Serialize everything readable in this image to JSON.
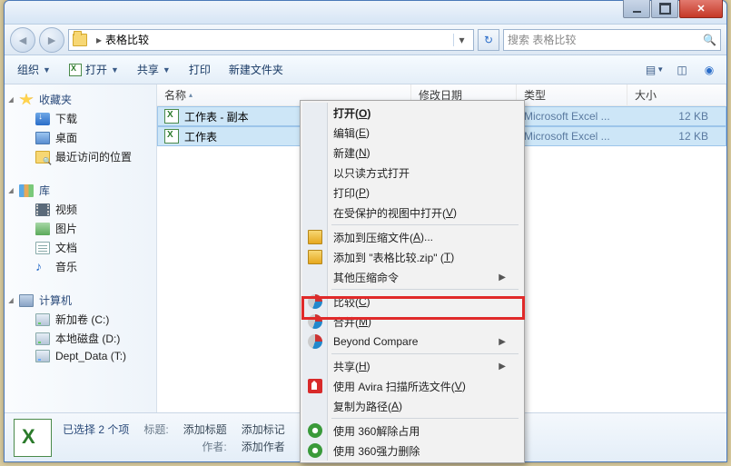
{
  "titlebar": {
    "minimize": "",
    "maximize": "",
    "close": ""
  },
  "nav": {
    "path_segment": "表格比较",
    "search_placeholder": "搜索 表格比较"
  },
  "toolbar": {
    "organize": "组织",
    "open": "打开",
    "share": "共享",
    "print": "打印",
    "new_folder": "新建文件夹"
  },
  "columns": {
    "name": "名称",
    "modified": "修改日期",
    "type": "类型",
    "size": "大小"
  },
  "files": [
    {
      "name": "工作表 - 副本",
      "type": "Microsoft Excel ...",
      "size": "12 KB"
    },
    {
      "name": "工作表",
      "type": "Microsoft Excel ...",
      "size": "12 KB"
    }
  ],
  "sidebar": {
    "favorites": {
      "head": "收藏夹",
      "items": [
        "下载",
        "桌面",
        "最近访问的位置"
      ]
    },
    "libraries": {
      "head": "库",
      "items": [
        "视频",
        "图片",
        "文档",
        "音乐"
      ]
    },
    "computer": {
      "head": "计算机",
      "items": [
        "新加卷 (C:)",
        "本地磁盘 (D:)",
        "Dept_Data (T:)"
      ]
    }
  },
  "context_menu": {
    "open": "打开(",
    "open_k": "O",
    "open_e": ")",
    "edit": "编辑(",
    "edit_k": "E",
    "edit_e": ")",
    "new": "新建(",
    "new_k": "N",
    "new_e": ")",
    "readonly": "以只读方式打开",
    "print": "打印(",
    "print_k": "P",
    "print_e": ")",
    "protected": "在受保护的视图中打开(",
    "protected_k": "V",
    "protected_e": ")",
    "add_archive": "添加到压缩文件(",
    "add_archive_k": "A",
    "add_archive_e": ")...",
    "add_zip": "添加到 \"表格比较.zip\" (",
    "add_zip_k": "T",
    "add_zip_e": ")",
    "other_comp": "其他压缩命令",
    "compare": "比较(",
    "compare_k": "C",
    "compare_e": ")",
    "merge": "合并(",
    "merge_k": "M",
    "merge_e": ")",
    "bc": "Beyond Compare",
    "share": "共享(",
    "share_k": "H",
    "share_e": ")",
    "avira": "使用 Avira 扫描所选文件(",
    "avira_k": "V",
    "avira_e": ")",
    "copypath": "复制为路径(",
    "copypath_k": "A",
    "copypath_e": ")",
    "s360a": "使用 360解除占用",
    "s360b": "使用 360强力删除"
  },
  "status": {
    "selected": "已选择 2 个项",
    "title_lbl": "标题:",
    "title_val": "添加标题",
    "author_lbl": "作者:",
    "author_val": "添加作者",
    "tags_lbl": "添加标记"
  }
}
